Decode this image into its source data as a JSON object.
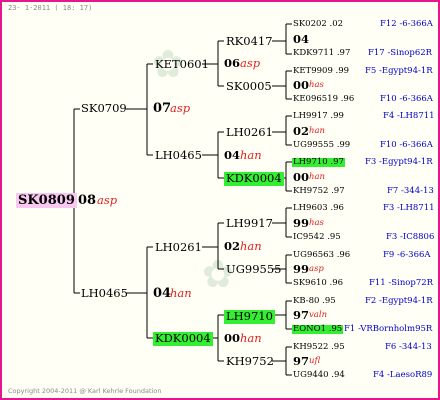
{
  "header": {
    "date": "23-  1-2011 ( 18: 17)"
  },
  "copyright": "Copyright 2004-2011 @ Karl Kehrle Foundation",
  "colors": {
    "border": "#e8168c",
    "line": "#000000",
    "highlight": "#33ee33",
    "root_bg": "#f8c8f0",
    "blue_text": "#0000c8",
    "red_text": "#e02020"
  },
  "gen1": {
    "id": "SK0809",
    "num": "08",
    "tag": "asp"
  },
  "gen2": {
    "sire": "SK0709",
    "dam": "LH0465"
  },
  "gen3": [
    {
      "num": "07",
      "tag": "asp"
    },
    {
      "num": "04",
      "tag": "han"
    }
  ],
  "gen4": [
    {
      "id": "KET0601"
    },
    {
      "id": "LH0465"
    },
    {
      "id": "LH0261"
    },
    {
      "id": "KDK0004"
    }
  ],
  "gen5": [
    {
      "num": "06",
      "tag": "asp"
    },
    {
      "num": "04",
      "tag": "han"
    },
    {
      "num": "02",
      "tag": "han"
    },
    {
      "num": "00",
      "tag": "han"
    }
  ],
  "gen6": [
    {
      "id": "RK0417"
    },
    {
      "id": "SK0005"
    },
    {
      "id": "LH0261"
    },
    {
      "id": "KDK0004"
    },
    {
      "id": "LH9917"
    },
    {
      "id": "UG99555"
    },
    {
      "id": "LH9710"
    },
    {
      "id": "KH9752"
    }
  ],
  "gen7": [
    {
      "top": "SK0202 .02",
      "top_info": "F12 -6-366A",
      "num": "04",
      "tag": "",
      "bottom": "KDK9711 .97",
      "bottom_info": "F17 -Sinop62R"
    },
    {
      "top": "KET9909 .99",
      "top_info": "F5 -Egypt94-1R",
      "num": "00",
      "tag": "has",
      "bottom": "KE096519 .96",
      "bottom_info": "F10 -6-366A"
    },
    {
      "top": "LH9917 .99",
      "top_info": "F4 -LH8711",
      "num": "02",
      "tag": "han",
      "bottom": "UG99555 .99",
      "bottom_info": "F10 -6-366A"
    },
    {
      "top": "LH9710 .97",
      "top_info": "F3 -Egypt94-1R",
      "num": "00",
      "tag": "han",
      "bottom": "KH9752 .97",
      "bottom_info": "F7 -344-13"
    },
    {
      "top": "LH9603 .96",
      "top_info": "F3 -LH8711",
      "num": "99",
      "tag": "has",
      "bottom": "IC9542 .95",
      "bottom_info": "F3 -IC8806"
    },
    {
      "top": "UG96563 .96",
      "top_info": "F9 -6-366A",
      "num": "99",
      "tag": "asp",
      "bottom": "SK9610 .96",
      "bottom_info": "F11 -Sinop72R"
    },
    {
      "top": "KB-80 .95",
      "top_info": "F2 -Egypt94-1R",
      "num": "97",
      "tag": "valn",
      "bottom": "EONO1 .95",
      "bottom_info": "F1 -VRBornholm95R"
    },
    {
      "top": "KH9522 .95",
      "top_info": "F6 -344-13",
      "num": "97",
      "tag": "ufl",
      "bottom": "UG9440 .94",
      "bottom_info": "F4 -LaesoR89"
    }
  ]
}
